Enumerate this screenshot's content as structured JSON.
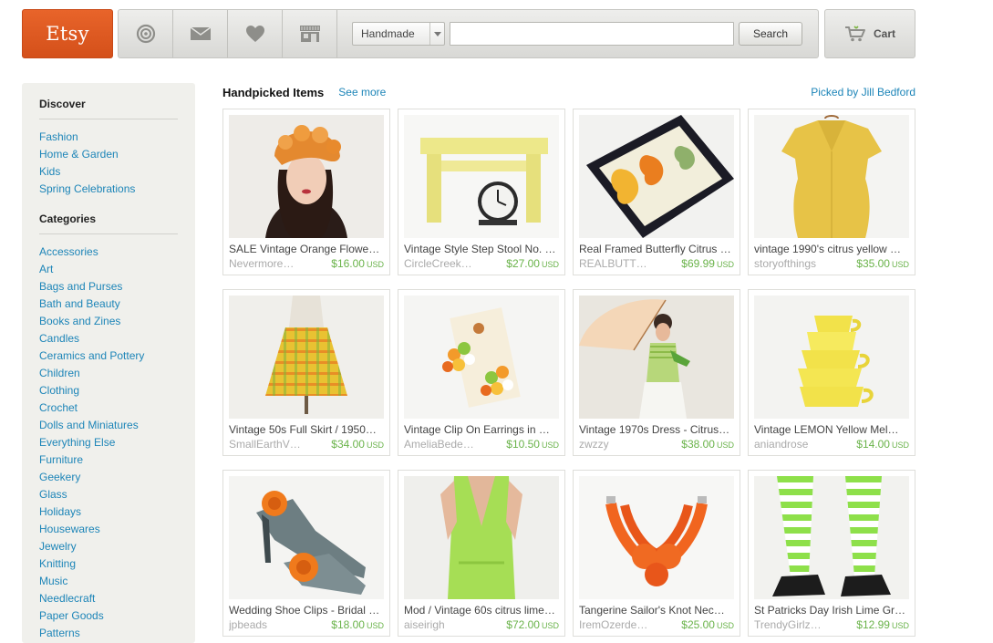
{
  "header": {
    "logo": "Etsy",
    "nav_icons": [
      "activity-icon",
      "mail-icon",
      "heart-icon",
      "shop-icon"
    ],
    "search": {
      "category": "Handmade",
      "value": "",
      "placeholder": "",
      "button": "Search"
    },
    "cart_label": "Cart"
  },
  "sidebar": {
    "discover": {
      "heading": "Discover",
      "items": [
        "Fashion",
        "Home & Garden",
        "Kids",
        "Spring Celebrations"
      ]
    },
    "categories": {
      "heading": "Categories",
      "items": [
        "Accessories",
        "Art",
        "Bags and Purses",
        "Bath and Beauty",
        "Books and Zines",
        "Candles",
        "Ceramics and Pottery",
        "Children",
        "Clothing",
        "Crochet",
        "Dolls and Miniatures",
        "Everything Else",
        "Furniture",
        "Geekery",
        "Glass",
        "Holidays",
        "Housewares",
        "Jewelry",
        "Knitting",
        "Music",
        "Needlecraft",
        "Paper Goods",
        "Patterns"
      ]
    }
  },
  "main": {
    "title": "Handpicked Items",
    "see_more": "See more",
    "picked_by": "Picked by Jill Bedford",
    "currency": "USD",
    "items": [
      {
        "title": "SALE Vintage Orange Flowe…",
        "shop": "Nevermore…",
        "price": "$16.00"
      },
      {
        "title": "Vintage Style Step Stool No. …",
        "shop": "CircleCreek…",
        "price": "$27.00"
      },
      {
        "title": "Real Framed Butterfly Citrus …",
        "shop": "REALBUTT…",
        "price": "$69.99"
      },
      {
        "title": "vintage 1990's citrus yellow …",
        "shop": "storyofthings",
        "price": "$35.00"
      },
      {
        "title": "Vintage 50s Full Skirt / 1950…",
        "shop": "SmallEarthV…",
        "price": "$34.00"
      },
      {
        "title": "Vintage Clip On Earrings in …",
        "shop": "AmeliaBede…",
        "price": "$10.50"
      },
      {
        "title": "Vintage 1970s Dress - Citrus…",
        "shop": "zwzzy",
        "price": "$38.00"
      },
      {
        "title": "Vintage LEMON Yellow Mel…",
        "shop": "aniandrose",
        "price": "$14.00"
      },
      {
        "title": "Wedding Shoe Clips - Bridal …",
        "shop": "jpbeads",
        "price": "$18.00"
      },
      {
        "title": "Mod / Vintage 60s citrus lime…",
        "shop": "aiseirigh",
        "price": "$72.00"
      },
      {
        "title": "Tangerine Sailor's Knot Nec…",
        "shop": "IremOzerde…",
        "price": "$25.00"
      },
      {
        "title": "St Patricks Day Irish Lime Gr…",
        "shop": "TrendyGirlz…",
        "price": "$12.99"
      }
    ]
  }
}
